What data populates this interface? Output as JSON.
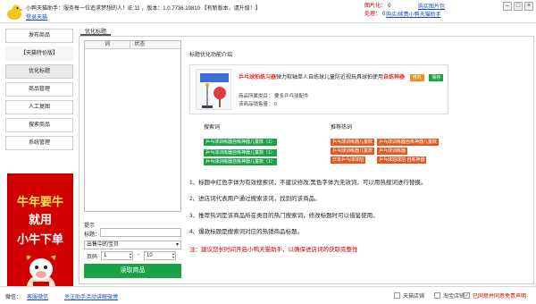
{
  "titlebar": {
    "title": "小鸭天猫助手：服务每一位追求梦想的人！IE:11 ，版本：1.0.7736.19810 【有新版本，请升级！】",
    "login_link": "登录天猫",
    "stats": [
      {
        "label": "图片化：",
        "value": "0"
      },
      {
        "label": "处理：",
        "value": "0"
      }
    ],
    "link_buy": "购买图片包",
    "link_tools": "购买/续费小鸭天猫助手"
  },
  "sidebar": {
    "items": [
      {
        "label": "发布商品",
        "kind": "normal"
      },
      {
        "label": "【天猫特价版】",
        "kind": "group"
      },
      {
        "label": "优化标题",
        "kind": "active"
      },
      {
        "label": "商品管理",
        "kind": "normal"
      },
      {
        "label": "人工复图",
        "kind": "normal"
      },
      {
        "label": "搜索商品",
        "kind": "normal"
      },
      {
        "label": "系统管理",
        "kind": "normal"
      }
    ],
    "ad": {
      "line1": "牛年要牛",
      "line2": "就用",
      "line3": "小牛下单"
    }
  },
  "main": {
    "tab": "优化标题",
    "table": {
      "col1": "词",
      "col2": "状态"
    },
    "tip_label": "提示",
    "tag_label": "标题：",
    "select_value": "出售中的宝贝",
    "page_label": "页码",
    "page_from": "1",
    "page_to": "10",
    "read_button": "读取商品"
  },
  "intro": {
    "title": "标题优化功能介绍",
    "product": {
      "name_red": "乒乓球拍练习器",
      "name_mid": "弹力软轴单人自练球儿童防近视玩具球拍使用",
      "name_red2": "自练神器",
      "btn_edit": "修改",
      "btn_save": "保存",
      "category": "商品所属类目：  要多乒乓球配件",
      "sales": "该商品销售量：  0"
    },
    "left_label": "搜索词",
    "right_label": "推荐热词",
    "green_tags": [
      "乒乓球训练器自练神器儿童款（1）",
      "乒乓球训练器自练神器儿童款（1）",
      "乒乓球训练器自练神器儿童款（1）"
    ],
    "orange_tags": [
      "乒乓球训练器儿童款",
      "乒乓球训练器自练神器儿童款",
      "乒乓球训练器儿童款",
      "乒乓球训练器",
      "日本乒乓球球拍",
      "乒乓球拍球拍 自练神器"
    ],
    "rules": [
      "1、标题中红色字体为有效搜索词，不建议修改,黑色字体为无效词，可以用热搜词进行替换。",
      "2、进店词代表用户通过搜索该词，找到的该商品。",
      "3、推荐热词是该商品所在类目的热门搜索词，修改标题时可以借鉴使用。",
      "4、爆款标题是搜索词对应的热销商品标题。"
    ],
    "note": "注：建议您长时间开启小鸭天猫助手，以确保进店词的获取完整性"
  },
  "status": {
    "label": "微信：",
    "link1": "客服微信",
    "link2": "关注助手活动讲解微博",
    "checks": [
      {
        "label": "天猫店铺",
        "checked": false,
        "red": false
      },
      {
        "label": "淘宝店铺",
        "checked": false,
        "red": false
      },
      {
        "label": "已同意并同意免责声明",
        "checked": true,
        "red": true
      }
    ]
  },
  "colors": {
    "green": "#19a346",
    "orange": "#e4571f",
    "red": "#cc0000",
    "link": "#1a4fc4"
  }
}
